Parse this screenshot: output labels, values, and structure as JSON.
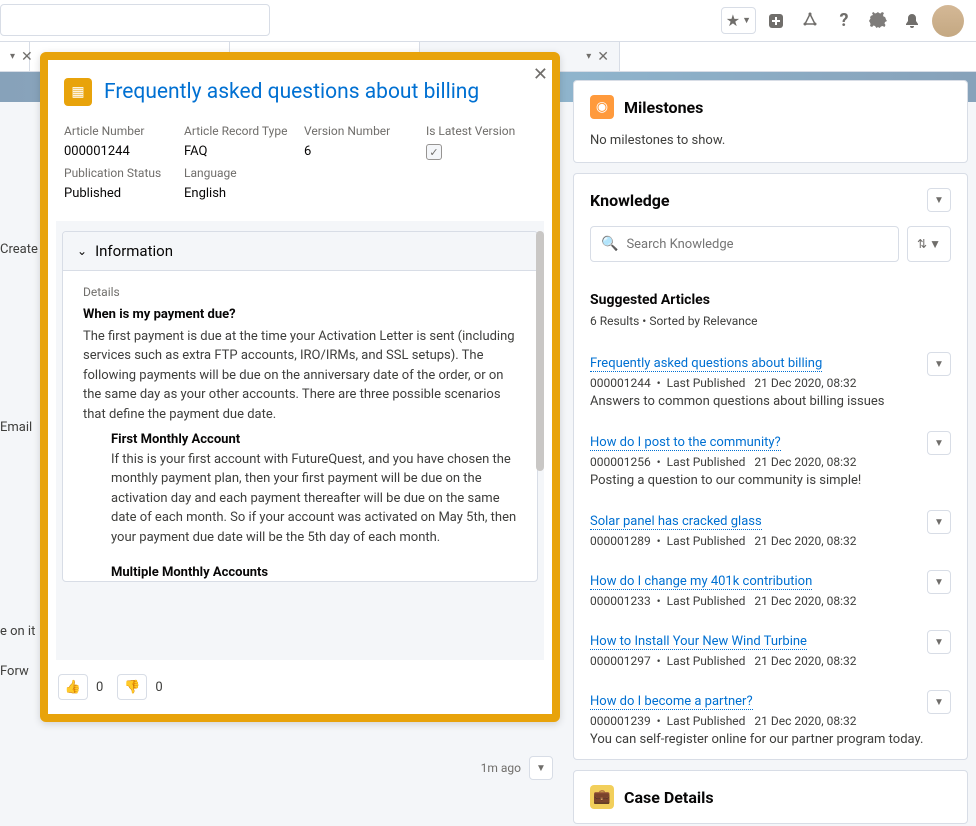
{
  "topbar": {
    "tabs_visible": [
      "Create",
      "Email",
      "e on it",
      "Forw"
    ]
  },
  "timestamp": "1m ago",
  "milestones": {
    "title": "Milestones",
    "empty": "No milestones to show."
  },
  "knowledge": {
    "title": "Knowledge",
    "search_placeholder": "Search Knowledge",
    "suggested_title": "Suggested Articles",
    "results_meta": "6 Results  •  Sorted by Relevance",
    "articles": [
      {
        "title": "Frequently asked questions about billing",
        "num": "000001244",
        "pub": "Last Published",
        "date": "21 Dec 2020, 08:32",
        "snippet": "Answers to common questions about billing issues"
      },
      {
        "title": "How do I post to the community?",
        "num": "000001256",
        "pub": "Last Published",
        "date": "21 Dec 2020, 08:32",
        "snippet": "Posting a question to our community is simple!"
      },
      {
        "title": "Solar panel has cracked glass",
        "num": "000001289",
        "pub": "Last Published",
        "date": "21 Dec 2020, 08:32",
        "snippet": ""
      },
      {
        "title": "How do I change my 401k contribution",
        "num": "000001233",
        "pub": "Last Published",
        "date": "21 Dec 2020, 08:32",
        "snippet": ""
      },
      {
        "title": "How to Install Your New Wind Turbine",
        "num": "000001297",
        "pub": "Last Published",
        "date": "21 Dec 2020, 08:32",
        "snippet": ""
      },
      {
        "title": "How do I become a partner?",
        "num": "000001239",
        "pub": "Last Published",
        "date": "21 Dec 2020, 08:32",
        "snippet": "You can self-register online for our partner program today."
      }
    ]
  },
  "case_details": {
    "title": "Case Details"
  },
  "modal": {
    "title": "Frequently asked questions about billing",
    "fields": {
      "article_number_label": "Article Number",
      "article_number": "000001244",
      "record_type_label": "Article Record Type",
      "record_type": "FAQ",
      "version_label": "Version Number",
      "version": "6",
      "latest_label": "Is Latest Version",
      "pub_status_label": "Publication Status",
      "pub_status": "Published",
      "language_label": "Language",
      "language": "English"
    },
    "section_title": "Information",
    "details_label": "Details",
    "q1": "When is my payment due?",
    "q1_body": "The first payment is due at the time your Activation Letter is sent (including services such as extra FTP accounts, IRO/IRMs, and SSL setups). The following payments will be due on the anniversary date of the order, or on the same day as your other accounts. There are three possible scenarios that define the payment due date.",
    "sub1_title": "First Monthly Account",
    "sub1_body": "If this is your first account with FutureQuest, and you have chosen the monthly payment plan, then your first payment will be due on the activation day and each payment thereafter will be due on the same date of each month. So if your account was activated on May 5th, then your payment due date will be the 5th day of each month.",
    "sub2_title": "Multiple Monthly Accounts",
    "likes": "0",
    "dislikes": "0"
  }
}
